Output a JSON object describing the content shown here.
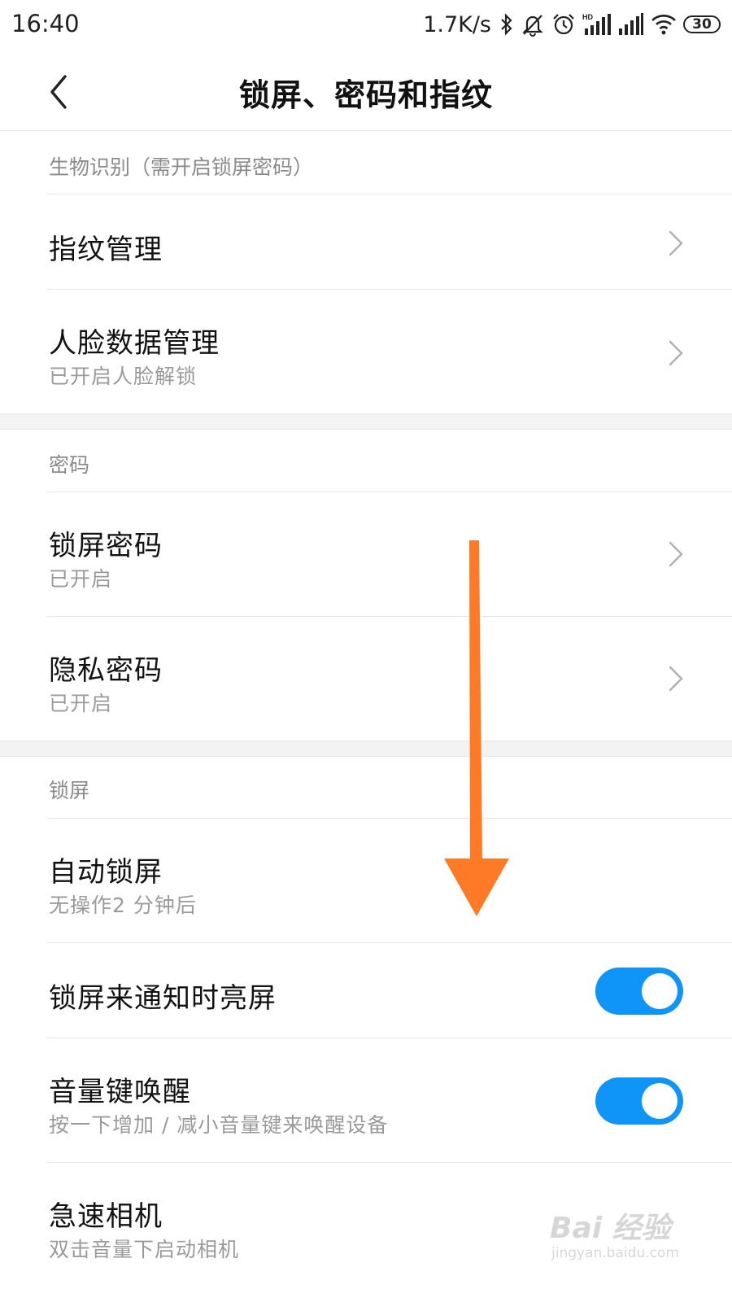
{
  "status_bar": {
    "time": "16:40",
    "net_speed": "1.7K/s",
    "icons": [
      "bluetooth-icon",
      "mute-icon",
      "alarm-icon",
      "hd-signal-icon",
      "signal-icon",
      "wifi-icon"
    ],
    "battery": "30"
  },
  "header": {
    "title": "锁屏、密码和指纹"
  },
  "sections": {
    "biometrics": {
      "title": "生物识别（需开启锁屏密码）",
      "items": [
        {
          "title": "指纹管理"
        },
        {
          "title": "人脸数据管理",
          "subtitle": "已开启人脸解锁"
        }
      ]
    },
    "password": {
      "title": "密码",
      "items": [
        {
          "title": "锁屏密码",
          "subtitle": "已开启"
        },
        {
          "title": "隐私密码",
          "subtitle": "已开启"
        }
      ]
    },
    "lockscreen": {
      "title": "锁屏",
      "items": [
        {
          "title": "自动锁屏",
          "subtitle": "无操作2 分钟后"
        },
        {
          "title": "锁屏来通知时亮屏",
          "toggle": true
        },
        {
          "title": "音量键唤醒",
          "subtitle": "按一下增加 / 减小音量键来唤醒设备",
          "toggle": true
        },
        {
          "title": "急速相机",
          "subtitle": "双击音量下启动相机"
        }
      ]
    }
  },
  "overlay": {
    "arrow_color": "#ff7a26"
  },
  "watermark": {
    "main": "Bai 经验",
    "sub": "jingyan.baidu.com"
  },
  "colors": {
    "toggle_on": "#0f94f8",
    "band": "#f3f3f3"
  }
}
